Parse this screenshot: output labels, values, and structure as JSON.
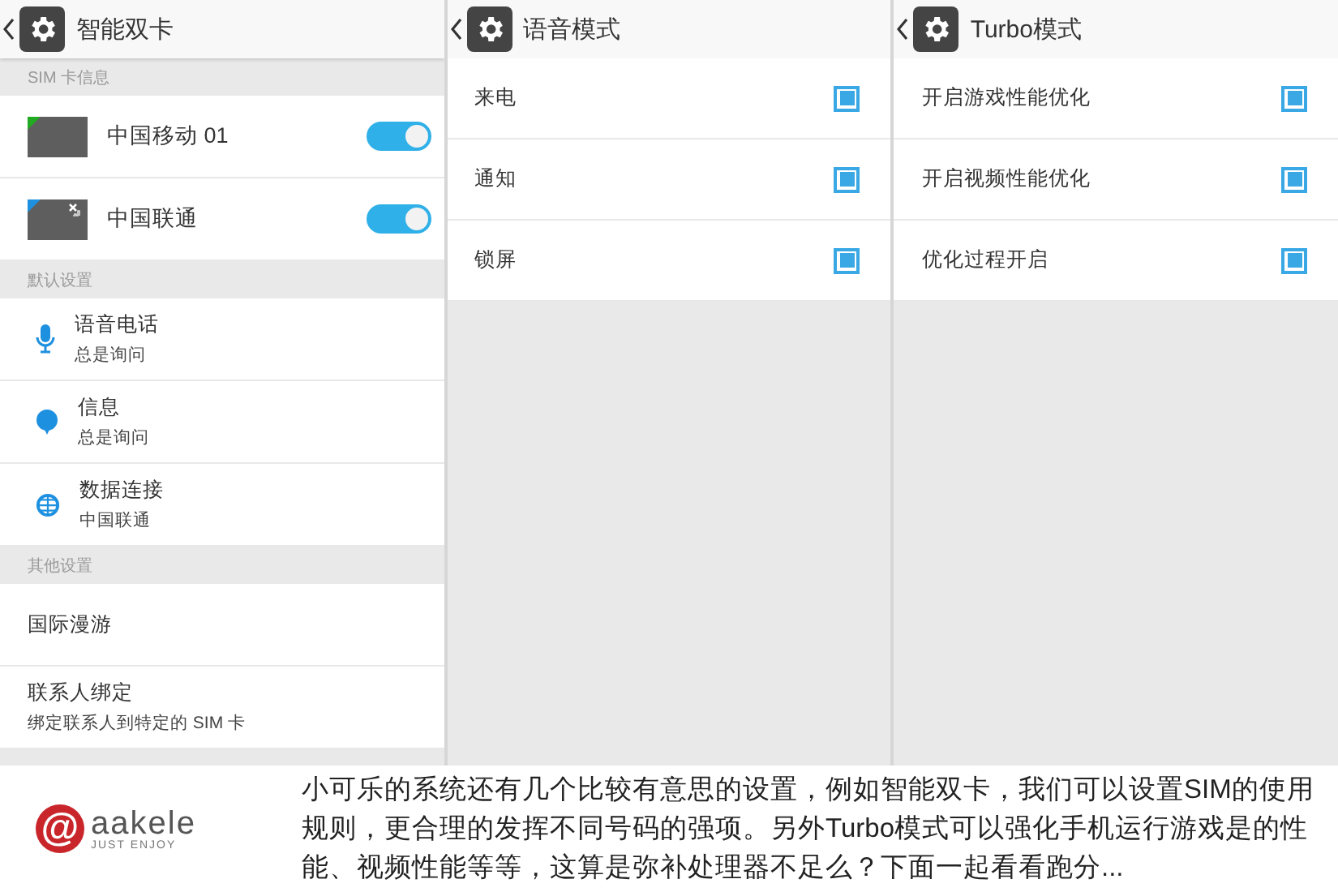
{
  "panels": [
    {
      "title": "智能双卡",
      "sections": [
        {
          "header": "SIM 卡信息",
          "items": [
            {
              "kind": "sim",
              "title": "中国移动 01",
              "color": "#22aa22",
              "no_service": false,
              "on": true
            },
            {
              "kind": "sim",
              "title": "中国联通",
              "color": "#1e90e0",
              "no_service": true,
              "on": true
            }
          ]
        },
        {
          "header": "默认设置",
          "items": [
            {
              "kind": "mic",
              "title": "语音电话",
              "subtitle": "总是询问"
            },
            {
              "kind": "bubble",
              "title": "信息",
              "subtitle": "总是询问"
            },
            {
              "kind": "globe",
              "title": "数据连接",
              "subtitle": "中国联通"
            }
          ]
        },
        {
          "header": "其他设置",
          "items": [
            {
              "kind": "plain",
              "title": "国际漫游"
            },
            {
              "kind": "plain",
              "title": "联系人绑定",
              "subtitle": "绑定联系人到特定的 SIM 卡"
            }
          ]
        }
      ]
    },
    {
      "title": "语音模式",
      "sections": [
        {
          "items": [
            {
              "kind": "check",
              "title": "来电",
              "checked": true
            },
            {
              "kind": "check",
              "title": "通知",
              "checked": true
            },
            {
              "kind": "check",
              "title": "锁屏",
              "checked": true
            }
          ]
        }
      ]
    },
    {
      "title": "Turbo模式",
      "sections": [
        {
          "items": [
            {
              "kind": "check",
              "title": "开启游戏性能优化",
              "checked": true
            },
            {
              "kind": "check",
              "title": "开启视频性能优化",
              "checked": true
            },
            {
              "kind": "check",
              "title": "优化过程开启",
              "checked": true
            }
          ]
        }
      ]
    }
  ],
  "caption": {
    "logo": {
      "mark": "@",
      "name": "aakele",
      "tagline": "JUST ENJOY"
    },
    "text": "小可乐的系统还有几个比较有意思的设置，例如智能双卡，我们可以设置SIM的使用规则，更合理的发挥不同号码的强项。另外Turbo模式可以强化手机运行游戏是的性能、视频性能等等，这算是弥补处理器不足么？下面一起看看跑分..."
  }
}
